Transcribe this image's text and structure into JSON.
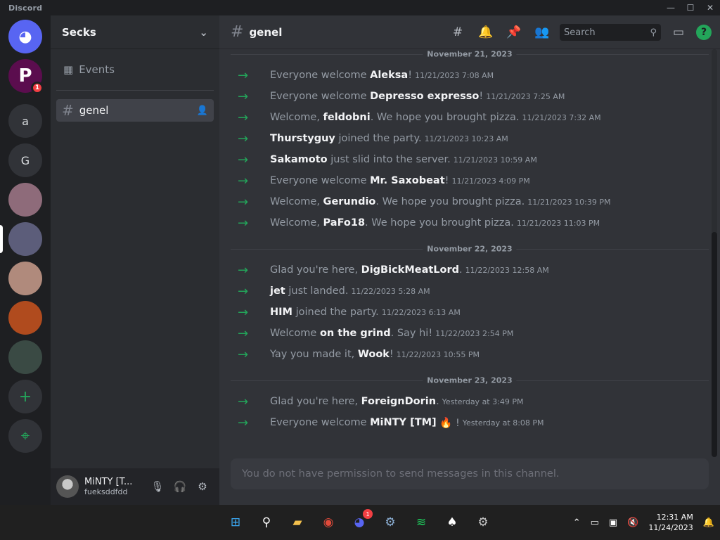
{
  "window": {
    "title": "Discord",
    "controls": [
      "—",
      "☐",
      "✕"
    ]
  },
  "servers": [
    {
      "label": "",
      "icon": "discord-logo-icon",
      "color": "#5865f2"
    },
    {
      "label": "P",
      "badge": "1",
      "color": "#5b0d4e"
    },
    {
      "label": "a",
      "color": "#313338"
    },
    {
      "label": "G",
      "color": "#313338"
    },
    {
      "label": "",
      "color": "#8e6b7a"
    },
    {
      "label": "",
      "color": "#5c5d7a"
    },
    {
      "label": "",
      "color": "#b08a7c"
    },
    {
      "label": "",
      "color": "#b04b1e"
    },
    {
      "label": "",
      "color": "#3a4a44"
    },
    {
      "label": "+",
      "icon": "add-server-icon",
      "color": "#313338"
    },
    {
      "label": "⌖",
      "icon": "explore-icon",
      "color": "#313338"
    }
  ],
  "sidebar": {
    "guild_name": "Secks",
    "events_label": "Events",
    "channel_name": "genel"
  },
  "user": {
    "name": "MiNTY [T...",
    "tag": "fueksddfdd"
  },
  "channel": {
    "name": "genel"
  },
  "search": {
    "placeholder": "Search"
  },
  "messages": [
    {
      "date": "November 21, 2023"
    },
    {
      "pre": "Everyone welcome ",
      "name": "Aleksa",
      "post": "!",
      "ts": "11/21/2023 7:08 AM"
    },
    {
      "pre": "Everyone welcome ",
      "name": "Depresso expresso",
      "post": "!",
      "ts": "11/21/2023 7:25 AM"
    },
    {
      "pre": "Welcome, ",
      "name": "feldobni",
      "post": ". We hope you brought pizza.",
      "ts": "11/21/2023 7:32 AM"
    },
    {
      "pre": "",
      "name": "Thurstyguy",
      "post": " joined the party.",
      "ts": "11/21/2023 10:23 AM"
    },
    {
      "pre": "",
      "name": "Sakamoto",
      "post": " just slid into the server.",
      "ts": "11/21/2023 10:59 AM"
    },
    {
      "pre": "Everyone welcome ",
      "name": "Mr. Saxobeat",
      "post": "!",
      "ts": "11/21/2023 4:09 PM"
    },
    {
      "pre": "Welcome, ",
      "name": "Gerundio",
      "post": ". We hope you brought pizza.",
      "ts": "11/21/2023 10:39 PM"
    },
    {
      "pre": "Welcome, ",
      "name": "PaFo18",
      "post": ". We hope you brought pizza.",
      "ts": "11/21/2023 11:03 PM"
    },
    {
      "date": "November 22, 2023"
    },
    {
      "pre": "Glad you're here, ",
      "name": "DigBickMeatLord",
      "post": ".",
      "ts": "11/22/2023 12:58 AM"
    },
    {
      "pre": "",
      "name": "jet",
      "post": " just landed.",
      "ts": "11/22/2023 5:28 AM"
    },
    {
      "pre": "",
      "name": "HIM",
      "post": " joined the party.",
      "ts": "11/22/2023 6:13 AM"
    },
    {
      "pre": "Welcome ",
      "name": "on the grind",
      "post": ". Say hi!",
      "ts": "11/22/2023 2:54 PM"
    },
    {
      "pre": "Yay you made it, ",
      "name": "Wook",
      "post": "!",
      "ts": "11/22/2023 10:55 PM"
    },
    {
      "date": "November 23, 2023"
    },
    {
      "pre": "Glad you're here, ",
      "name": "ForeignDorin",
      "post": ".",
      "ts": "Yesterday at 3:49 PM"
    },
    {
      "pre": "Everyone welcome ",
      "name": "MiNTY [TM]",
      "post": " 🔥 !",
      "ts": "Yesterday at 8:08 PM"
    }
  ],
  "composer": {
    "text": "You do not have permission to send messages in this channel."
  },
  "taskbar": {
    "apps": [
      {
        "name": "start-button",
        "glyph": "⊞",
        "color": "#3ba7f0"
      },
      {
        "name": "search-button",
        "glyph": "⚲",
        "color": "#ffffff"
      },
      {
        "name": "file-explorer-button",
        "glyph": "▰",
        "color": "#f3c04d"
      },
      {
        "name": "chrome-button",
        "glyph": "◉",
        "color": "#e04a3a"
      },
      {
        "name": "discord-taskbar-button",
        "glyph": "◕",
        "color": "#5865f2",
        "badge": "1"
      },
      {
        "name": "steam-button",
        "glyph": "⚙",
        "color": "#8fb3d9"
      },
      {
        "name": "spotify-button",
        "glyph": "≋",
        "color": "#1ed760"
      },
      {
        "name": "solitaire-button",
        "glyph": "♠",
        "color": "#ffffff"
      },
      {
        "name": "settings-button",
        "glyph": "⚙",
        "color": "#c7c7c7"
      }
    ],
    "time": "12:31 AM",
    "date": "11/24/2023"
  }
}
